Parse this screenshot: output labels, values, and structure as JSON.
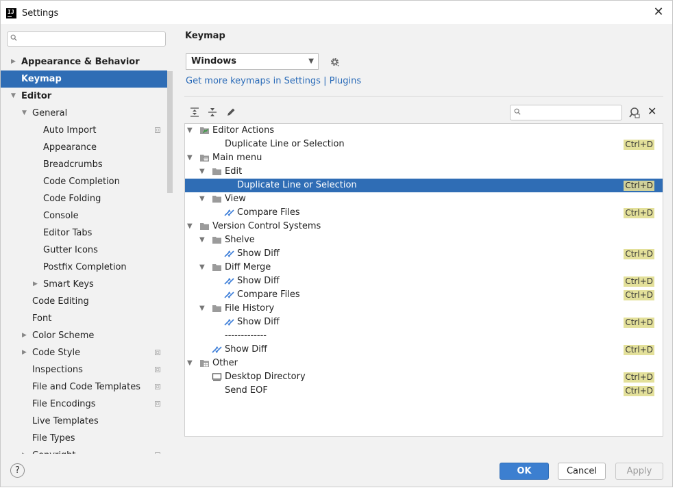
{
  "window": {
    "title": "Settings"
  },
  "sidebar": {
    "items": [
      {
        "label": "Appearance & Behavior",
        "level": 0,
        "arrow": "collapsed",
        "bold": true
      },
      {
        "label": "Keymap",
        "level": 0,
        "arrow": "none",
        "bold": true,
        "selected": true
      },
      {
        "label": "Editor",
        "level": 0,
        "arrow": "expanded",
        "bold": true
      },
      {
        "label": "General",
        "level": 1,
        "arrow": "expanded"
      },
      {
        "label": "Auto Import",
        "level": 2,
        "arrow": "none",
        "project": true
      },
      {
        "label": "Appearance",
        "level": 2,
        "arrow": "none"
      },
      {
        "label": "Breadcrumbs",
        "level": 2,
        "arrow": "none"
      },
      {
        "label": "Code Completion",
        "level": 2,
        "arrow": "none"
      },
      {
        "label": "Code Folding",
        "level": 2,
        "arrow": "none"
      },
      {
        "label": "Console",
        "level": 2,
        "arrow": "none"
      },
      {
        "label": "Editor Tabs",
        "level": 2,
        "arrow": "none"
      },
      {
        "label": "Gutter Icons",
        "level": 2,
        "arrow": "none"
      },
      {
        "label": "Postfix Completion",
        "level": 2,
        "arrow": "none"
      },
      {
        "label": "Smart Keys",
        "level": 2,
        "arrow": "collapsed"
      },
      {
        "label": "Code Editing",
        "level": 1,
        "arrow": "none"
      },
      {
        "label": "Font",
        "level": 1,
        "arrow": "none"
      },
      {
        "label": "Color Scheme",
        "level": 1,
        "arrow": "collapsed"
      },
      {
        "label": "Code Style",
        "level": 1,
        "arrow": "collapsed",
        "project": true
      },
      {
        "label": "Inspections",
        "level": 1,
        "arrow": "none",
        "project": true
      },
      {
        "label": "File and Code Templates",
        "level": 1,
        "arrow": "none",
        "project": true
      },
      {
        "label": "File Encodings",
        "level": 1,
        "arrow": "none",
        "project": true
      },
      {
        "label": "Live Templates",
        "level": 1,
        "arrow": "none"
      },
      {
        "label": "File Types",
        "level": 1,
        "arrow": "none"
      },
      {
        "label": "Copyright",
        "level": 1,
        "arrow": "collapsed",
        "project": true
      }
    ]
  },
  "keymap": {
    "heading": "Keymap",
    "scheme": "Windows",
    "link_prefix": "Get more keymaps in Settings | ",
    "link_plugins": "Plugins",
    "rows": [
      {
        "label": "Editor Actions",
        "level": 0,
        "arrow": "expanded",
        "icon": "editor-actions-icon"
      },
      {
        "label": "Duplicate Line or Selection",
        "level": 1,
        "arrow": "none",
        "icon": "",
        "shortcut": "Ctrl+D"
      },
      {
        "label": "Main menu",
        "level": 0,
        "arrow": "expanded",
        "icon": "main-menu-icon"
      },
      {
        "label": "Edit",
        "level": 1,
        "arrow": "expanded",
        "icon": "folder-icon"
      },
      {
        "label": "Duplicate Line or Selection",
        "level": 2,
        "arrow": "none",
        "icon": "",
        "shortcut": "Ctrl+D",
        "selected": true
      },
      {
        "label": "View",
        "level": 1,
        "arrow": "expanded",
        "icon": "folder-icon"
      },
      {
        "label": "Compare Files",
        "level": 2,
        "arrow": "none",
        "icon": "diff-icon",
        "shortcut": "Ctrl+D"
      },
      {
        "label": "Version Control Systems",
        "level": 0,
        "arrow": "expanded",
        "icon": "folder-icon"
      },
      {
        "label": "Shelve",
        "level": 1,
        "arrow": "expanded",
        "icon": "folder-icon"
      },
      {
        "label": "Show Diff",
        "level": 2,
        "arrow": "none",
        "icon": "diff-icon",
        "shortcut": "Ctrl+D"
      },
      {
        "label": "Diff  Merge",
        "level": 1,
        "arrow": "expanded",
        "icon": "folder-icon"
      },
      {
        "label": "Show Diff",
        "level": 2,
        "arrow": "none",
        "icon": "diff-icon",
        "shortcut": "Ctrl+D"
      },
      {
        "label": "Compare Files",
        "level": 2,
        "arrow": "none",
        "icon": "diff-icon",
        "shortcut": "Ctrl+D"
      },
      {
        "label": "File History",
        "level": 1,
        "arrow": "expanded",
        "icon": "folder-icon"
      },
      {
        "label": "Show Diff",
        "level": 2,
        "arrow": "none",
        "icon": "diff-icon",
        "shortcut": "Ctrl+D"
      },
      {
        "label": "-------------",
        "level": 1,
        "arrow": "none",
        "icon": ""
      },
      {
        "label": "Show Diff",
        "level": 1,
        "arrow": "none",
        "icon": "diff-icon",
        "shortcut": "Ctrl+D"
      },
      {
        "label": "Other",
        "level": 0,
        "arrow": "expanded",
        "icon": "other-icon"
      },
      {
        "label": "Desktop Directory",
        "level": 1,
        "arrow": "none",
        "icon": "desktop-icon",
        "shortcut": "Ctrl+D"
      },
      {
        "label": "Send EOF",
        "level": 1,
        "arrow": "none",
        "icon": "",
        "shortcut": "Ctrl+D"
      }
    ]
  },
  "footer": {
    "help": "?",
    "ok": "OK",
    "cancel": "Cancel",
    "apply": "Apply"
  },
  "colors": {
    "selection": "#2f6db5",
    "link": "#2a6bb8",
    "shortcut_bg": "#e3e09a",
    "primary_button": "#3c7fd0"
  }
}
